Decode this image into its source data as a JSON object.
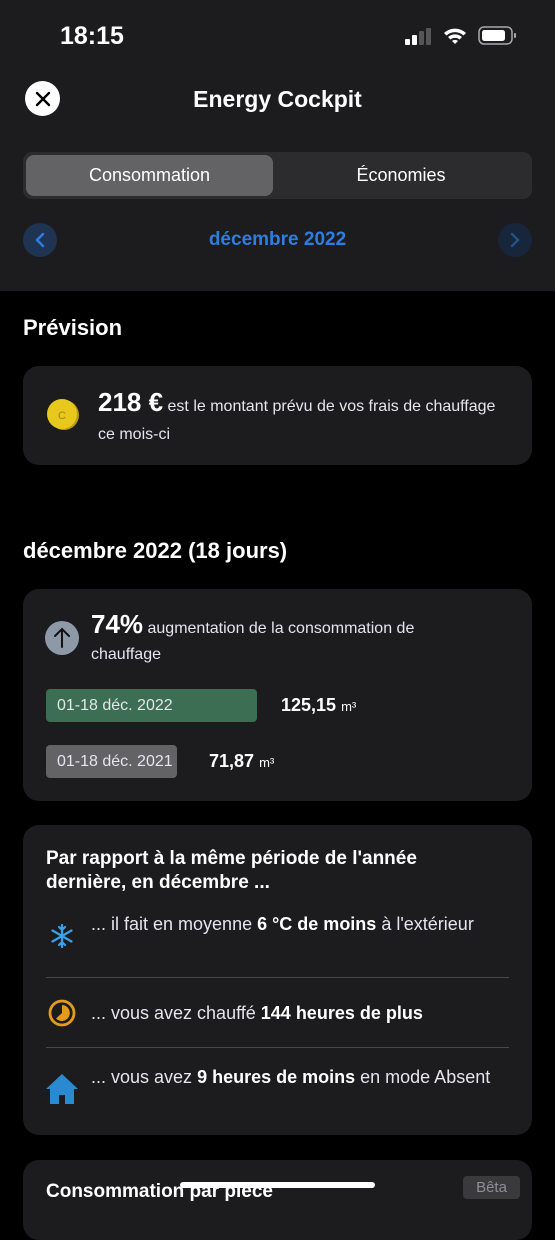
{
  "status_bar": {
    "time": "18:15"
  },
  "header": {
    "title": "Energy Cockpit",
    "tabs": [
      "Consommation",
      "Économies"
    ],
    "selected_tab": "Consommation",
    "month": "décembre 2022"
  },
  "forecast": {
    "heading": "Prévision",
    "amount": "218 €",
    "text": "est le montant prévu de vos frais de chauffage ce mois-ci",
    "coin_letter": "C"
  },
  "period": {
    "heading": "décembre 2022 (18 jours)",
    "change": "74%",
    "change_text": "augmentation de la consommation de chauffage",
    "bars": [
      {
        "label": "01-18 déc. 2022",
        "value": "125,15",
        "unit": "m³",
        "color": "#3b6e52",
        "fraction": 1.0
      },
      {
        "label": "01-18 déc. 2021",
        "value": "71,87",
        "unit": "m³",
        "color": "#636366",
        "fraction": 0.574
      }
    ]
  },
  "comparison": {
    "heading": "Par rapport à la même période de l'année dernière, en décembre ...",
    "rows": [
      {
        "icon": "snowflake-icon",
        "pre": "... il fait en moyenne ",
        "bold": "6 °C de moins",
        "post": " à l'extérieur"
      },
      {
        "icon": "clock-icon",
        "pre": "... vous avez chauffé ",
        "bold": "144 heures de plus",
        "post": ""
      },
      {
        "icon": "home-icon",
        "pre": "... vous avez ",
        "bold": "9 heures de moins",
        "post": " en mode Absent"
      }
    ]
  },
  "room_consumption": {
    "heading": "Consommation par pièce",
    "badge": "Bêta"
  },
  "colors": {
    "accent": "#2f7de1",
    "green": "#3b6e52",
    "card": "#1c1c1e"
  }
}
